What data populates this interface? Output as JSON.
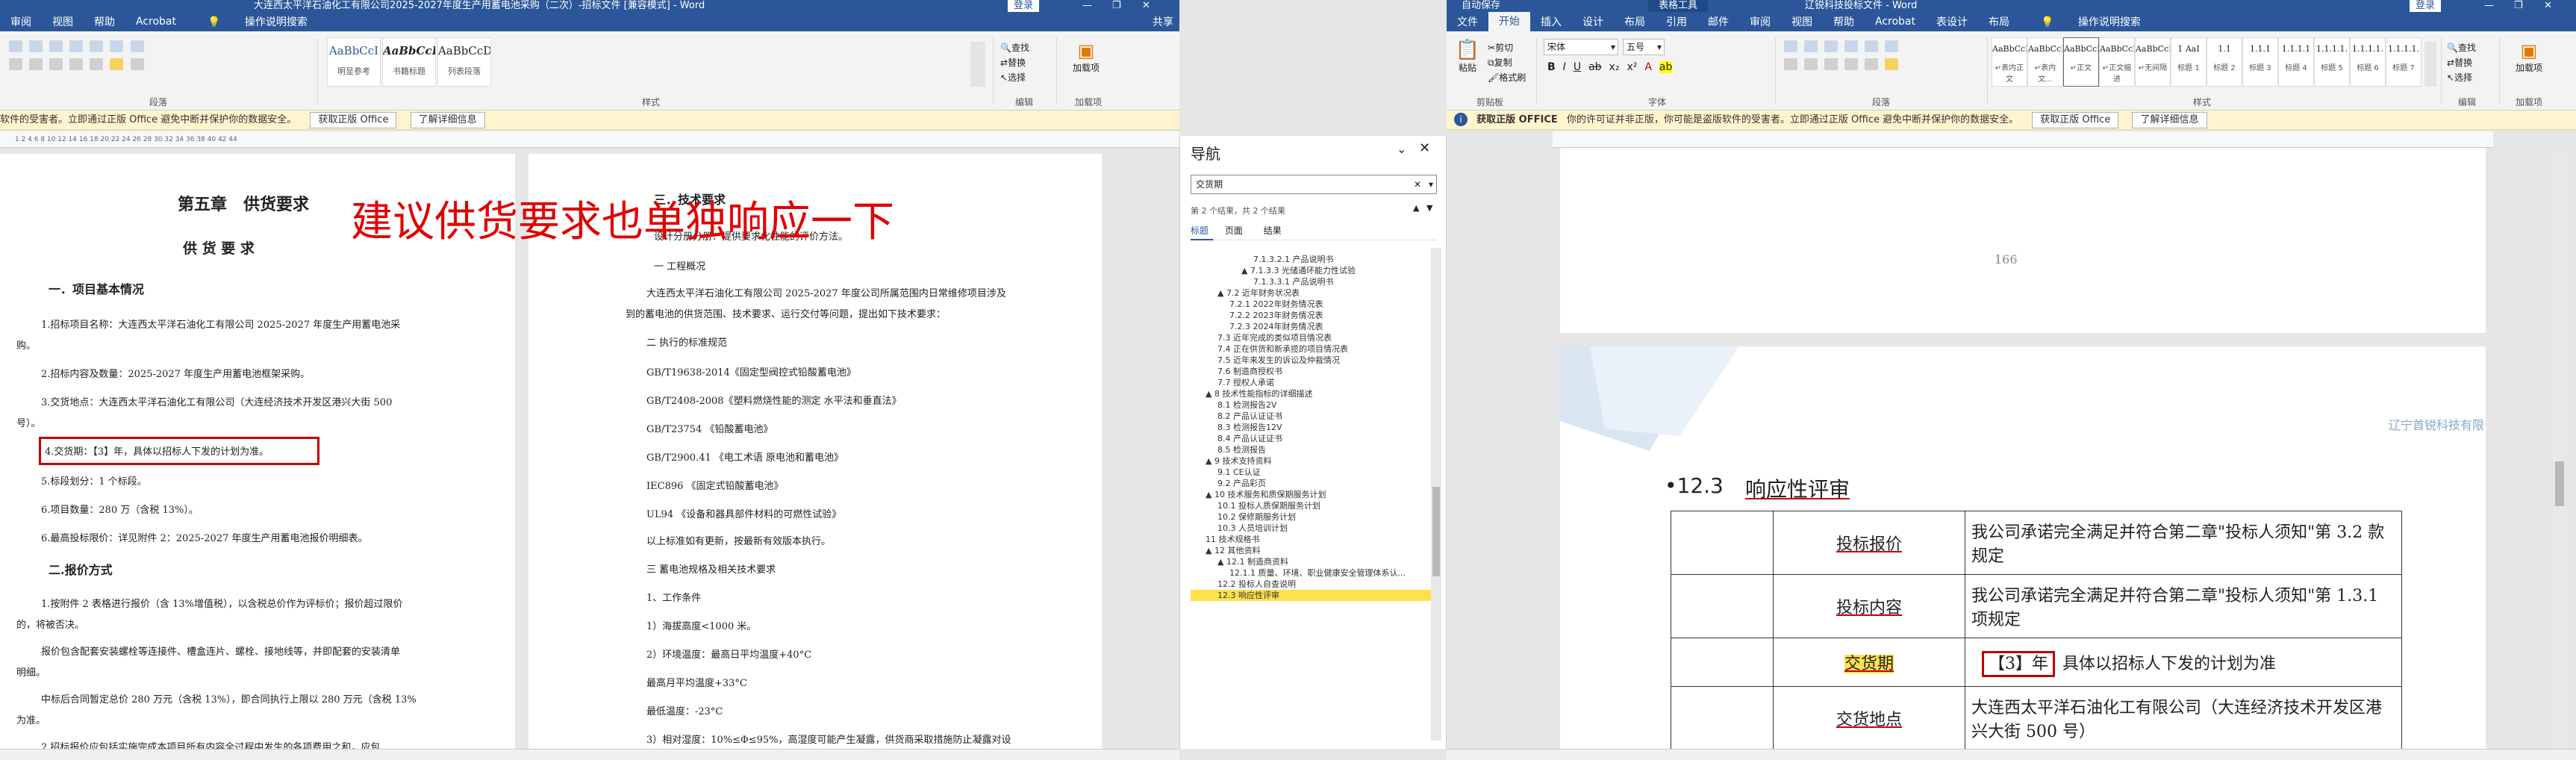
{
  "left_window": {
    "title": "大连西太平洋石油化工有限公司2025-2027年度生产用蓄电池采购（二次）-招标文件 [兼容模式] - Word",
    "sign_in": "登录",
    "share": "共享",
    "tabs": [
      "审阅",
      "视图",
      "帮助",
      "Acrobat",
      "操作说明搜索"
    ],
    "ribbon": {
      "style_samples": [
        {
          "sample": "AaBbCcI",
          "name": "明显参考"
        },
        {
          "sample": "AaBbCcDc",
          "name": "书籍标题"
        },
        {
          "sample": "AaBbCcDd",
          "name": "列表段落"
        }
      ],
      "edit_items": [
        "查找",
        "替换",
        "选择"
      ],
      "group_labels": [
        "段落",
        "样式",
        "编辑",
        "加载项"
      ],
      "addin": "加载项"
    },
    "warning": {
      "text": "软件的受害者。立即通过正版 Office 避免中断并保护你的数据安全。",
      "btn1": "获取正版 Office",
      "btn2": "了解详细信息"
    },
    "ruler": "1 2 4 6 8 10 12 14 16 18 20 22 24 26 28 30 32 34 36 38 40 42 44",
    "page1": {
      "chapter": "第五章　供货要求",
      "subtitle": "供 货 要 求",
      "section1": "一．项目基本情况",
      "p1": "1.招标项目名称：大连西太平洋石油化工有限公司 2025-2027 年度生产用蓄电池采",
      "p1b": "购。",
      "p2": "2.招标内容及数量：2025-2027 年度生产用蓄电池框架采购。",
      "p3": "3.交货地点：大连西太平洋石油化工有限公司（大连经济技术开发区港兴大街 500",
      "p3b": "号）。",
      "p4": "4.交货期：【3】年，具体以招标人下发的计划为准。",
      "p5": "5.标段划分：1 个标段。",
      "p6": "6.项目数量：280 万（含税 13%）。",
      "p7": "6.最高投标限价：详见附件 2：2025-2027 年度生产用蓄电池报价明细表。",
      "section2": "二.报价方式",
      "q1": "1.按附件 2 表格进行报价（含 13%增值税），以含税总价作为评标价；报价超过限价",
      "q1b": "的，将被否决。",
      "q2": "报价包含配套安装螺栓等连接件、槽盒连片、螺栓、接地线等，并即配套的安装清单",
      "q2b": "明细。",
      "q3": "中标后合同暂定总价 280 万元（含税 13%），即合同执行上限以 280 万元（含税 13%",
      "q3b": "为准。",
      "q4": "2.招标报价应包括实施完成本项目所有内容全过程中发生的各项费用之和，应包"
    },
    "annotation": "建议供货要求也单独响应一下",
    "page2": {
      "h1": "三．技术要求",
      "l1": "设计分册分册：提供要求化性能的评价方法。",
      "l2": "一 工程概况",
      "l3": "大连西太平洋石油化工有限公司 2025-2027 年度公司所属范围内日常维修项目涉及",
      "l4": "到的蓄电池的供货范围、技术要求、运行交付等问题，提出如下技术要求：",
      "l5": "二 执行的标准规范",
      "l6": "GB/T19638-2014《固定型阀控式铅酸蓄电池》",
      "l7": "GB/T2408-2008《塑料燃烧性能的测定 水平法和垂直法》",
      "l8": "GB/T23754 《铅酸蓄电池》",
      "l9": "GB/T2900.41 《电工术语 原电池和蓄电池》",
      "l10": "IEC896 《固定式铅酸蓄电池》",
      "l11": "UL94 《设备和器具部件材料的可燃性试验》",
      "l12": "以上标准如有更新，按最新有效版本执行。",
      "l13": "三 蓄电池规格及相关技术要求",
      "l14": "1、工作条件",
      "l15": "1）海拔高度<1000 米。",
      "l16": "2）环境温度：最高日平均温度+40°C",
      "l17": "最高月平均温度+33°C",
      "l18": "最低温度：-23°C",
      "l19": "3）相对湿度：10%≤Φ≤95%，高湿度可能产生凝露，供货商采取措施防止凝露对设"
    }
  },
  "navigation": {
    "title": "导航",
    "search_value": "交货期",
    "result_count": "第 2 个结果，共 2 个结果",
    "tabs": [
      "标题",
      "页面",
      "结果"
    ],
    "items": [
      {
        "text": "7.1.3.2.1 产品说明书",
        "level": 3
      },
      {
        "text": "▲ 7.1.3.3 光储通环能力性试验",
        "level": 2
      },
      {
        "text": "7.1.3.3.1 产品说明书",
        "level": 3
      },
      {
        "text": "▲ 7.2 近年财务状况表",
        "level": 0
      },
      {
        "text": "7.2.1 2022年财务情况表",
        "level": 1
      },
      {
        "text": "7.2.2 2023年财务情况表",
        "level": 1
      },
      {
        "text": "7.2.3 2024年财务情况表",
        "level": 1
      },
      {
        "text": "7.3 近年完成的类似项目情况表",
        "level": 0
      },
      {
        "text": "7.4 正在供货和新承揽的项目情况表",
        "level": 0
      },
      {
        "text": "7.5 近年来发生的诉讼及仲裁情况",
        "level": 0
      },
      {
        "text": "7.6 制造商授权书",
        "level": 0
      },
      {
        "text": "7.7 授权人承诺",
        "level": 0
      },
      {
        "text": "▲ 8 技术性能指标的详细描述",
        "level": -1
      },
      {
        "text": "8.1 检测报告2V",
        "level": 0
      },
      {
        "text": "8.2 产品认证证书",
        "level": 0
      },
      {
        "text": "8.3 检测报告12V",
        "level": 0
      },
      {
        "text": "8.4 产品认证证书",
        "level": 0
      },
      {
        "text": "8.5 检测报告",
        "level": 0
      },
      {
        "text": "▲ 9 技术支持资料",
        "level": -1
      },
      {
        "text": "9.1 CE认证",
        "level": 0
      },
      {
        "text": "9.2 产品彩页",
        "level": 0
      },
      {
        "text": "▲ 10 技术服务和质保期服务计划",
        "level": -1
      },
      {
        "text": "10.1 投标人质保期服务计划",
        "level": 0
      },
      {
        "text": "10.2 保修期服务计划",
        "level": 0
      },
      {
        "text": "10.3 人员培训计划",
        "level": 0
      },
      {
        "text": "11 技术规格书",
        "level": -1
      },
      {
        "text": "▲ 12 其他资料",
        "level": -1
      },
      {
        "text": "▲ 12.1 制造商资料",
        "level": 0
      },
      {
        "text": "12.1.1 质量、环境、职业健康安全管理体系认...",
        "level": 1
      },
      {
        "text": "12.2 投标人自查说明",
        "level": 0
      },
      {
        "text": "12.3 响应性评审",
        "level": 0,
        "selected": true
      }
    ]
  },
  "right_window": {
    "title": "辽锐科技投标文件 - Word",
    "context_tab": "表格工具",
    "sign_in": "登录",
    "quick_access": "自动保存",
    "tabs": [
      "文件",
      "开始",
      "插入",
      "设计",
      "布局",
      "引用",
      "邮件",
      "审阅",
      "视图",
      "帮助",
      "Acrobat",
      "表设计",
      "布局",
      "操作说明搜索"
    ],
    "ribbon": {
      "clipboard": [
        "剪切",
        "复制",
        "格式刷"
      ],
      "paste": "粘贴",
      "font_name": "宋体",
      "font_size": "五号",
      "styles": [
        {
          "sample": "AaBbCcDd",
          "name": "↵表内正文"
        },
        {
          "sample": "AaBbCcDc",
          "name": "↵表内文..."
        },
        {
          "sample": "AaBbCcDd",
          "name": "↵正文"
        },
        {
          "sample": "AaBbCcDd",
          "name": "↵正文缩进"
        },
        {
          "sample": "AaBbCcDd",
          "name": "↵无间隔"
        },
        {
          "sample": "1  AaI",
          "name": "标题 1"
        },
        {
          "sample": "1.1",
          "name": "标题 2"
        },
        {
          "sample": "1.1.1",
          "name": "标题 3"
        },
        {
          "sample": "1.1.1.1",
          "name": "标题 4"
        },
        {
          "sample": "1.1.1.1.",
          "name": "标题 5"
        },
        {
          "sample": "1.1.1.1.",
          "name": "标题 6"
        },
        {
          "sample": "1.1.1.1.",
          "name": "标题 7"
        }
      ],
      "edit_items": [
        "查找",
        "替换",
        "选择"
      ],
      "group_labels": [
        "剪贴板",
        "字体",
        "段落",
        "样式",
        "编辑",
        "加载项"
      ],
      "addin": "加载项"
    },
    "warning": {
      "label": "获取正版 OFFICE",
      "text": "你的许可证并非正版，你可能是盗版软件的受害者。立即通过正版 Office 避免中断并保护你的数据安全。",
      "btn1": "获取正版 Office",
      "btn2": "了解详细信息"
    },
    "page_top": {
      "page_number": "166"
    },
    "page_bottom": {
      "header": "辽宁首锐科技有限公司--投标文件",
      "heading_num": "•12.3",
      "heading": "响应性评审",
      "table": [
        {
          "label": "投标报价",
          "content": "我公司承诺完全满足并符合第二章\"投标人须知\"第 3.2 款规定"
        },
        {
          "label": "投标内容",
          "content": "我公司承诺完全满足并符合第二章\"投标人须知\"第 1.3.1 项规定"
        },
        {
          "label": "交货期",
          "content": "具体以招标人下发的计划为准",
          "boxed": "【3】年"
        },
        {
          "label": "交货地点",
          "content": "大连西太平洋石油化工有限公司（大连经济技术开发区港兴大街 500 号）"
        }
      ]
    }
  },
  "colors": {
    "word_blue": "#2b579a",
    "annotation_red": "#e00000",
    "highlight_yellow": "#ffe14d",
    "redbox": "#c00000"
  }
}
